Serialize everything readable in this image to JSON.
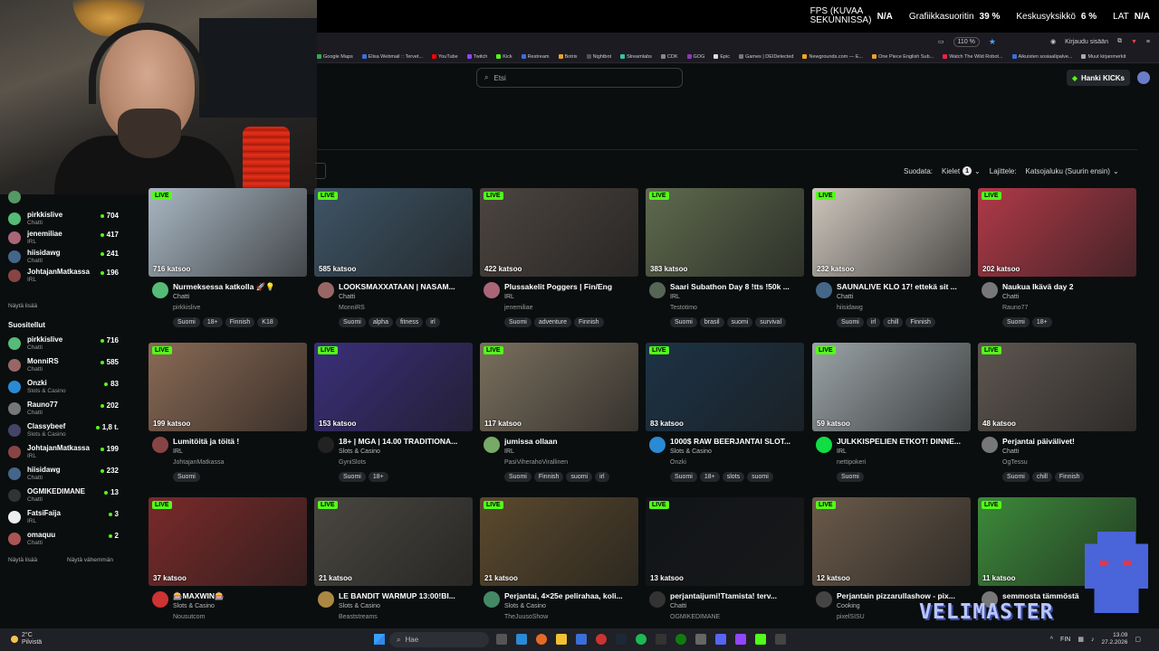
{
  "overlay": {
    "fps_label": "FPS (KUVAA SEKUNNISSA)",
    "fps_value": "N/A",
    "gpu_label": "Grafiikkasuoritin",
    "gpu_value": "39 %",
    "cpu_label": "Keskusyksikkö",
    "cpu_value": "6 %",
    "lat_label": "LAT",
    "lat_value": "N/A"
  },
  "browser": {
    "zoom": "110 %",
    "login": "Kirjaudu sisään",
    "bookmarks": [
      {
        "label": "Google Maps",
        "color": "#34a853"
      },
      {
        "label": "Elisa Webmail :: Tervet...",
        "color": "#3a6fd8"
      },
      {
        "label": "YouTube",
        "color": "#ff0000"
      },
      {
        "label": "Twitch",
        "color": "#9146ff"
      },
      {
        "label": "Kick",
        "color": "#53fc18"
      },
      {
        "label": "Restream",
        "color": "#3a6fd8"
      },
      {
        "label": "Botrix",
        "color": "#e8a030"
      },
      {
        "label": "Nightbot",
        "color": "#555"
      },
      {
        "label": "Streamlabs",
        "color": "#31c3a2"
      },
      {
        "label": "CDK",
        "color": "#888"
      },
      {
        "label": "GOG",
        "color": "#8a3ab9"
      },
      {
        "label": "Epic",
        "color": "#ddd"
      },
      {
        "label": "Games | DEIDetected",
        "color": "#777"
      },
      {
        "label": "Newgrounds.com — E...",
        "color": "#f5a623"
      },
      {
        "label": "One Piece English Sub...",
        "color": "#e8a030"
      },
      {
        "label": "Watch The Wild Robot...",
        "color": "#e24"
      },
      {
        "label": "Aikuisten sosiaalipalve...",
        "color": "#3a6fd8"
      },
      {
        "label": "Muut kirjanmerkit",
        "color": "#aaa"
      }
    ]
  },
  "header": {
    "search_placeholder": "Etsi",
    "cta_label": "Hanki KICKs"
  },
  "filters": {
    "filter_label": "Suodata:",
    "languages_label": "Kielet",
    "languages_count": "1",
    "sort_label": "Lajittele:",
    "sort_value": "Katsojaluku (Suurin ensin)"
  },
  "sidebar": {
    "recommended": [
      {
        "name": "pirkkislive",
        "category": "Chatti",
        "viewers": "704",
        "color": "#5b7"
      },
      {
        "name": "jenemiliae",
        "category": "IRL",
        "viewers": "417",
        "color": "#a67"
      },
      {
        "name": "hiisidawg",
        "category": "Chatti",
        "viewers": "241",
        "color": "#468"
      },
      {
        "name": "JohtajanMatkassa",
        "category": "IRL",
        "viewers": "196",
        "color": "#844"
      }
    ],
    "show_more": "Näytä lisää",
    "following_heading": "Suositellut",
    "following": [
      {
        "name": "pirkkislive",
        "category": "Chatti",
        "viewers": "716",
        "color": "#5b7"
      },
      {
        "name": "MonniRS",
        "category": "Chatti",
        "viewers": "585",
        "color": "#966"
      },
      {
        "name": "Onzki",
        "category": "Slots & Casino",
        "viewers": "83",
        "color": "#2a8ad4"
      },
      {
        "name": "Rauno77",
        "category": "Chatti",
        "viewers": "202",
        "color": "#777"
      },
      {
        "name": "Classybeef",
        "category": "Slots & Casino",
        "viewers": "1,8 t.",
        "color": "#446"
      },
      {
        "name": "JohtajanMatkassa",
        "category": "IRL",
        "viewers": "199",
        "color": "#844"
      },
      {
        "name": "hiisidawg",
        "category": "Chatti",
        "viewers": "232",
        "color": "#468"
      },
      {
        "name": "OGMIKEDIMANE",
        "category": "Chatti",
        "viewers": "13",
        "color": "#333"
      },
      {
        "name": "FatsiFaija",
        "category": "IRL",
        "viewers": "3",
        "color": "#eee"
      },
      {
        "name": "omaquu",
        "category": "Chatti",
        "viewers": "2",
        "color": "#a55"
      }
    ],
    "show_more_2": "Näytä lisää",
    "show_less": "Näytä vähemmän"
  },
  "streams": [
    {
      "title": "Nurmeksessa katkolla 🚀💡",
      "category": "Chatti",
      "user": "pirkkislive",
      "viewers": "716 katsoo",
      "tags": [
        "Suomi",
        "18+",
        "Finnish",
        "K18"
      ],
      "thumb": "#a9b7c3",
      "av": "#5b7"
    },
    {
      "title": "LOOKSMAXXATAAN | NASAM...",
      "category": "Chatti",
      "user": "MonniRS",
      "viewers": "585 katsoo",
      "tags": [
        "Suomi",
        "alpha",
        "fitness",
        "irl"
      ],
      "thumb": "#3e5566",
      "av": "#966"
    },
    {
      "title": "Plussakelit Poggers | Fin/Eng",
      "category": "IRL",
      "user": "jenemiliae",
      "viewers": "422 katsoo",
      "tags": [
        "Suomi",
        "adventure",
        "Finnish"
      ],
      "thumb": "#4c4540",
      "av": "#a67"
    },
    {
      "title": "Saari Subathon Day 8 !tts !50k ...",
      "category": "IRL",
      "user": "Testotimo",
      "viewers": "383 katsoo",
      "tags": [
        "Suomi",
        "brasil",
        "suomi",
        "survival"
      ],
      "thumb": "#5f6a4e",
      "av": "#565"
    },
    {
      "title": "SAUNALIVE KLO 17! ettekä sit ...",
      "category": "Chatti",
      "user": "hiisidawg",
      "viewers": "232 katsoo",
      "tags": [
        "Suomi",
        "irl",
        "chill",
        "Finnish"
      ],
      "thumb": "#cdc6bc",
      "av": "#468"
    },
    {
      "title": "Naukua Ikävä day 2",
      "category": "Chatti",
      "user": "Rauno77",
      "viewers": "202 katsoo",
      "tags": [
        "Suomi",
        "18+"
      ],
      "thumb": "#b03a48",
      "av": "#777"
    },
    {
      "title": "Lumitöitä ja töitä !",
      "category": "IRL",
      "user": "JohtajanMatkassa",
      "viewers": "199 katsoo",
      "tags": [
        "Suomi"
      ],
      "thumb": "#8a6a55",
      "av": "#844"
    },
    {
      "title": "18+ | MGA | 14.00 TRADITIONA...",
      "category": "Slots & Casino",
      "user": "GyniSlots",
      "viewers": "153 katsoo",
      "tags": [
        "Suomi",
        "18+"
      ],
      "thumb": "#3a2f7a",
      "av": "#222"
    },
    {
      "title": "jumissa ollaan",
      "category": "IRL",
      "user": "PasiViherahoVirallinen",
      "viewers": "117 katsoo",
      "tags": [
        "Suomi",
        "Finnish",
        "suomi",
        "irl"
      ],
      "thumb": "#7a6f5e",
      "av": "#7a6"
    },
    {
      "title": "1000$ RAW BEERJANTAI SLOT...",
      "category": "Slots & Casino",
      "user": "Onzki",
      "viewers": "83 katsoo",
      "tags": [
        "Suomi",
        "18+",
        "slots",
        "suomi"
      ],
      "thumb": "#1c3346",
      "av": "#2a8ad4"
    },
    {
      "title": "JULKKISPELIEN ETKOT! DINNE...",
      "category": "IRL",
      "user": "nettipokeri",
      "viewers": "59 katsoo",
      "tags": [
        "Suomi"
      ],
      "thumb": "#9aa3a6",
      "av": "#1d4"
    },
    {
      "title": "Perjantai päivälivet!",
      "category": "Chatti",
      "user": "OgTessu",
      "viewers": "48 katsoo",
      "tags": [
        "Suomi",
        "chill",
        "Finnish"
      ],
      "thumb": "#5e5650",
      "av": "#777"
    },
    {
      "title": "🎰MAXWIN🎰",
      "category": "Slots & Casino",
      "user": "Nousutcom",
      "viewers": "37 katsoo",
      "tags": [],
      "thumb": "#7a2a2a",
      "av": "#c33"
    },
    {
      "title": "LE BANDIT WARMUP 13:00!BI...",
      "category": "Slots & Casino",
      "user": "Beaststreams",
      "viewers": "21 katsoo",
      "tags": [],
      "thumb": "#4a4740",
      "av": "#a84"
    },
    {
      "title": "Perjantai, 4×25e pelirahaa, koli...",
      "category": "Slots & Casino",
      "user": "TheJuusoShow",
      "viewers": "21 katsoo",
      "tags": [],
      "thumb": "#5b4a2e",
      "av": "#486"
    },
    {
      "title": "perjantaijumi!Ttamista! terv...",
      "category": "Chatti",
      "user": "OGMIKEDIMANE",
      "viewers": "13 katsoo",
      "tags": [],
      "thumb": "#111418",
      "av": "#333"
    },
    {
      "title": "Perjantain pizzarullashow - pix...",
      "category": "Cooking",
      "user": "pixelSISU",
      "viewers": "12 katsoo",
      "tags": [],
      "thumb": "#6a5a4a",
      "av": "#444"
    },
    {
      "title": "semmosta tämmöstä",
      "category": "",
      "user": "",
      "viewers": "11 katsoo",
      "tags": [],
      "thumb": "#3c8a3a",
      "av": "#777"
    }
  ],
  "live_label": "LIVE",
  "taskbar": {
    "temp": "2°C",
    "weather": "Pilvistä",
    "search": "Hae",
    "lang": "FIN",
    "time": "13.09",
    "date": "27.2.2026"
  },
  "watermark": "VELIMASTER"
}
